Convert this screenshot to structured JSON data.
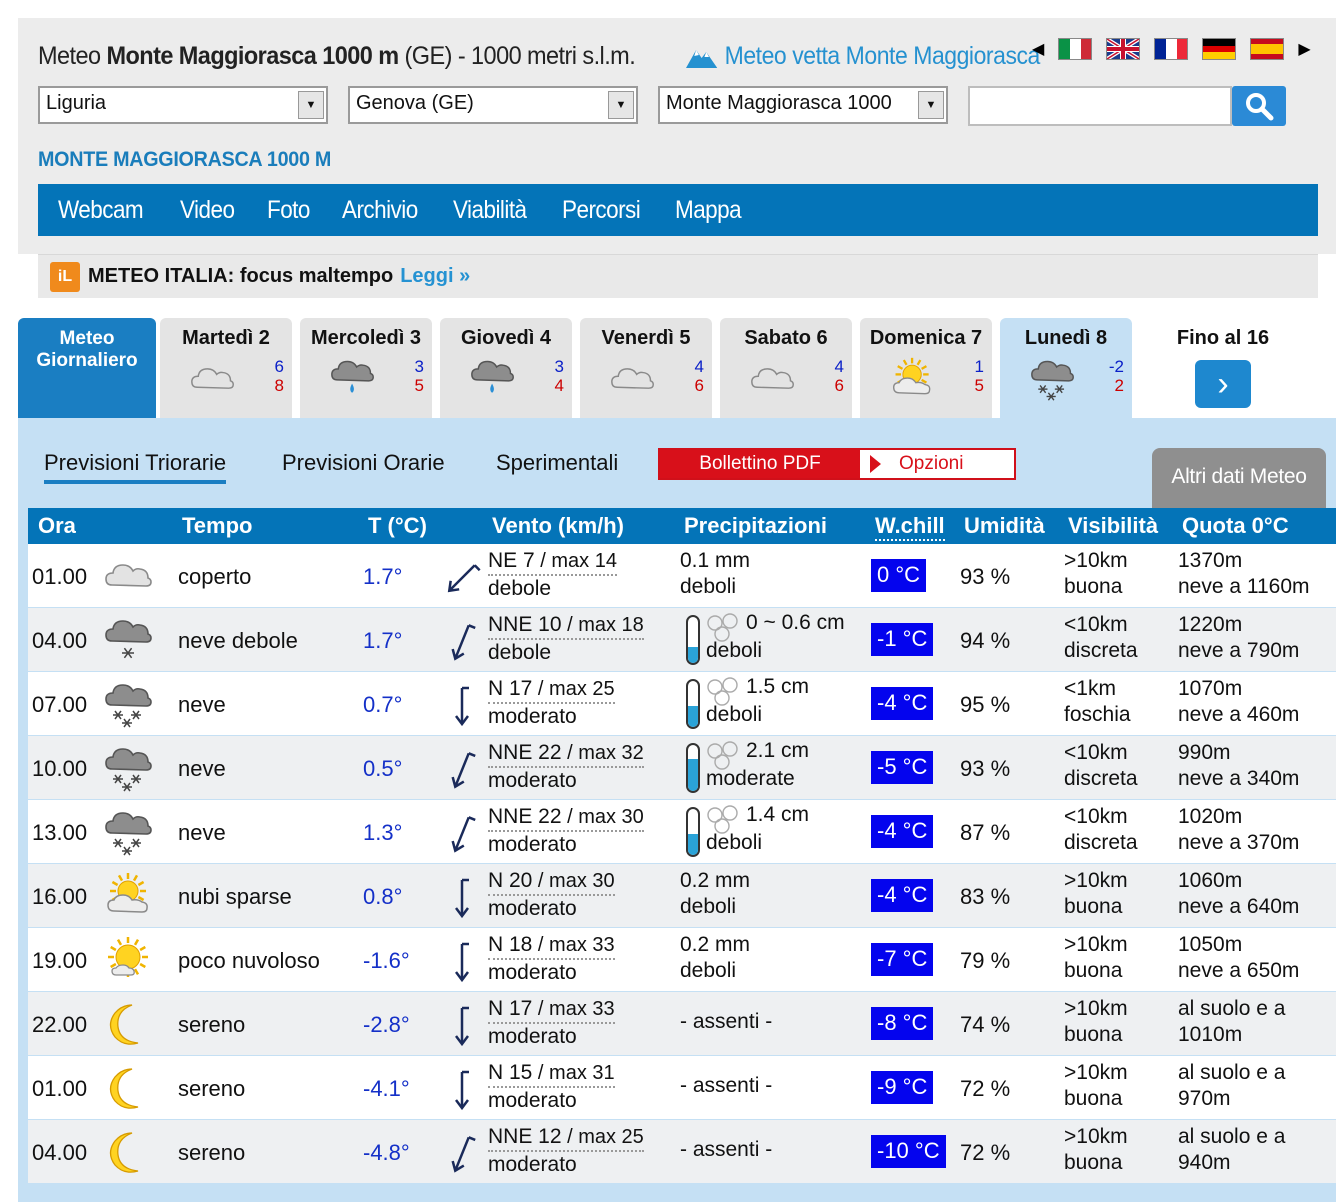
{
  "header": {
    "title_prefix": "Meteo ",
    "title_bold": "Monte Maggiorasca 1000 m",
    "title_suffix": " (GE) - 1000 metri s.l.m.",
    "peak_link": "Meteo vetta Monte Maggiorasca",
    "flags": [
      "italian-flag",
      "british-flag",
      "french-flag",
      "german-flag",
      "spanish-flag"
    ],
    "selects": {
      "region": "Liguria",
      "province": "Genova (GE)",
      "locality": "Monte Maggiorasca 1000"
    },
    "search": {
      "value": "",
      "icon": "search-icon"
    },
    "location_heading": "MONTE MAGGIORASCA 1000 M",
    "nav": [
      "Webcam",
      "Video",
      "Foto",
      "Archivio",
      "Viabilità",
      "Percorsi",
      "Mappa"
    ]
  },
  "news": {
    "logo": "iL",
    "prefix": "METEO ITALIA:",
    "text": " focus maltempo",
    "link": "Leggi »"
  },
  "day_tabs": {
    "meteo_label_1": "Meteo",
    "meteo_label_2": "Giornaliero",
    "days": [
      {
        "name": "Martedì 2",
        "min": "6",
        "max": "8",
        "icon": "cloud"
      },
      {
        "name": "Mercoledì 3",
        "min": "3",
        "max": "5",
        "icon": "rain"
      },
      {
        "name": "Giovedì 4",
        "min": "3",
        "max": "4",
        "icon": "rain"
      },
      {
        "name": "Venerdì 5",
        "min": "4",
        "max": "6",
        "icon": "cloud"
      },
      {
        "name": "Sabato 6",
        "min": "4",
        "max": "6",
        "icon": "cloud"
      },
      {
        "name": "Domenica 7",
        "min": "1",
        "max": "5",
        "icon": "sun-cloud"
      },
      {
        "name": "Lunedì 8",
        "min": "-2",
        "max": "2",
        "icon": "snow",
        "active": true
      }
    ],
    "until_label": "Fino al 16"
  },
  "subtabs": {
    "triorarie": "Previsioni Triorarie",
    "orarie": "Previsioni Orarie",
    "sperimentali": "Sperimentali",
    "pdf": "Bollettino PDF",
    "opzioni": "Opzioni",
    "altri": "Altri dati Meteo"
  },
  "table": {
    "headers": {
      "ora": "Ora",
      "tempo": "Tempo",
      "temp": "T (°C)",
      "vento": "Vento (km/h)",
      "precip": "Precipitazioni",
      "wchill": "W.chill",
      "umidita": "Umidità",
      "visibilita": "Visibilità",
      "quota": "Quota 0°C"
    },
    "rows": [
      {
        "ora": "01.00",
        "icon": "cloud",
        "desc": "coperto",
        "temp": "1.7°",
        "dir_deg": 45,
        "wind_dir": "NE 7",
        "wind_max": " / max 14",
        "wind_label": "debole",
        "precip_type": "rain",
        "precip1": "0.1 mm",
        "precip2": "deboli",
        "fill": 0,
        "wc": "0 °C",
        "hum": "93 %",
        "vis1": ">10km",
        "vis2": "buona",
        "q1": "1370m",
        "q2": "neve a 1160m"
      },
      {
        "ora": "04.00",
        "icon": "snow-light",
        "desc": "neve debole",
        "temp": "1.7°",
        "dir_deg": 22,
        "wind_dir": "NNE 10",
        "wind_max": " / max 18",
        "wind_label": "debole",
        "precip_type": "snow",
        "precip1": "0 ~ 0.6 cm",
        "precip2": "deboli",
        "fill": 0.35,
        "wc": "-1 °C",
        "hum": "94 %",
        "vis1": "<10km",
        "vis2": "discreta",
        "q1": "1220m",
        "q2": "neve a 790m"
      },
      {
        "ora": "07.00",
        "icon": "snow",
        "desc": "neve",
        "temp": "0.7°",
        "dir_deg": 0,
        "wind_dir": "N 17",
        "wind_max": " / max 25",
        "wind_label": "moderato",
        "precip_type": "snow",
        "precip1": "1.5 cm",
        "precip2": "deboli",
        "fill": 0.45,
        "wc": "-4 °C",
        "hum": "95 %",
        "vis1": "<1km",
        "vis2": "foschia",
        "q1": "1070m",
        "q2": "neve a 460m"
      },
      {
        "ora": "10.00",
        "icon": "snow",
        "desc": "neve",
        "temp": "0.5°",
        "dir_deg": 22,
        "wind_dir": "NNE 22",
        "wind_max": " / max 32",
        "wind_label": "moderato",
        "precip_type": "snow",
        "precip1": "2.1 cm",
        "precip2": "moderate",
        "fill": 0.7,
        "wc": "-5 °C",
        "hum": "93 %",
        "vis1": "<10km",
        "vis2": "discreta",
        "q1": "990m",
        "q2": "neve a 340m"
      },
      {
        "ora": "13.00",
        "icon": "snow",
        "desc": "neve",
        "temp": "1.3°",
        "dir_deg": 22,
        "wind_dir": "NNE 22",
        "wind_max": " / max 30",
        "wind_label": "moderato",
        "precip_type": "snow",
        "precip1": "1.4 cm",
        "precip2": "deboli",
        "fill": 0.45,
        "wc": "-4 °C",
        "hum": "87 %",
        "vis1": "<10km",
        "vis2": "discreta",
        "q1": "1020m",
        "q2": "neve a 370m"
      },
      {
        "ora": "16.00",
        "icon": "sun-cloud",
        "desc": "nubi sparse",
        "temp": "0.8°",
        "dir_deg": 0,
        "wind_dir": "N 20",
        "wind_max": " / max 30",
        "wind_label": "moderato",
        "precip_type": "rain",
        "precip1": "0.2 mm",
        "precip2": "deboli",
        "fill": 0,
        "wc": "-4 °C",
        "hum": "83 %",
        "vis1": ">10km",
        "vis2": "buona",
        "q1": "1060m",
        "q2": "neve a 640m"
      },
      {
        "ora": "19.00",
        "icon": "sun-small-cloud",
        "desc": "poco nuvoloso",
        "temp": "-1.6°",
        "dir_deg": 0,
        "wind_dir": "N 18",
        "wind_max": " / max 33",
        "wind_label": "moderato",
        "precip_type": "rain",
        "precip1": "0.2 mm",
        "precip2": "deboli",
        "fill": 0,
        "wc": "-7 °C",
        "hum": "79 %",
        "vis1": ">10km",
        "vis2": "buona",
        "q1": "1050m",
        "q2": "neve a 650m"
      },
      {
        "ora": "22.00",
        "icon": "moon",
        "desc": "sereno",
        "temp": "-2.8°",
        "dir_deg": 0,
        "wind_dir": "N 17",
        "wind_max": " / max 33",
        "wind_label": "moderato",
        "precip_type": "none",
        "precip1": "- assenti -",
        "precip2": "",
        "fill": 0,
        "wc": "-8 °C",
        "hum": "74 %",
        "vis1": ">10km",
        "vis2": "buona",
        "q1": "al suolo e a",
        "q2": "1010m"
      },
      {
        "ora": "01.00",
        "icon": "moon",
        "desc": "sereno",
        "temp": "-4.1°",
        "dir_deg": 0,
        "wind_dir": "N 15",
        "wind_max": " / max 31",
        "wind_label": "moderato",
        "precip_type": "none",
        "precip1": "- assenti -",
        "precip2": "",
        "fill": 0,
        "wc": "-9 °C",
        "hum": "72 %",
        "vis1": ">10km",
        "vis2": "buona",
        "q1": "al suolo e a",
        "q2": "970m"
      },
      {
        "ora": "04.00",
        "icon": "moon",
        "desc": "sereno",
        "temp": "-4.8°",
        "dir_deg": 22,
        "wind_dir": "NNE 12",
        "wind_max": " / max 25",
        "wind_label": "moderato",
        "precip_type": "none",
        "precip1": "- assenti -",
        "precip2": "",
        "fill": 0,
        "wc": "-10 °C",
        "hum": "72 %",
        "vis1": ">10km",
        "vis2": "buona",
        "q1": "al suolo e a",
        "q2": "940m"
      }
    ]
  }
}
